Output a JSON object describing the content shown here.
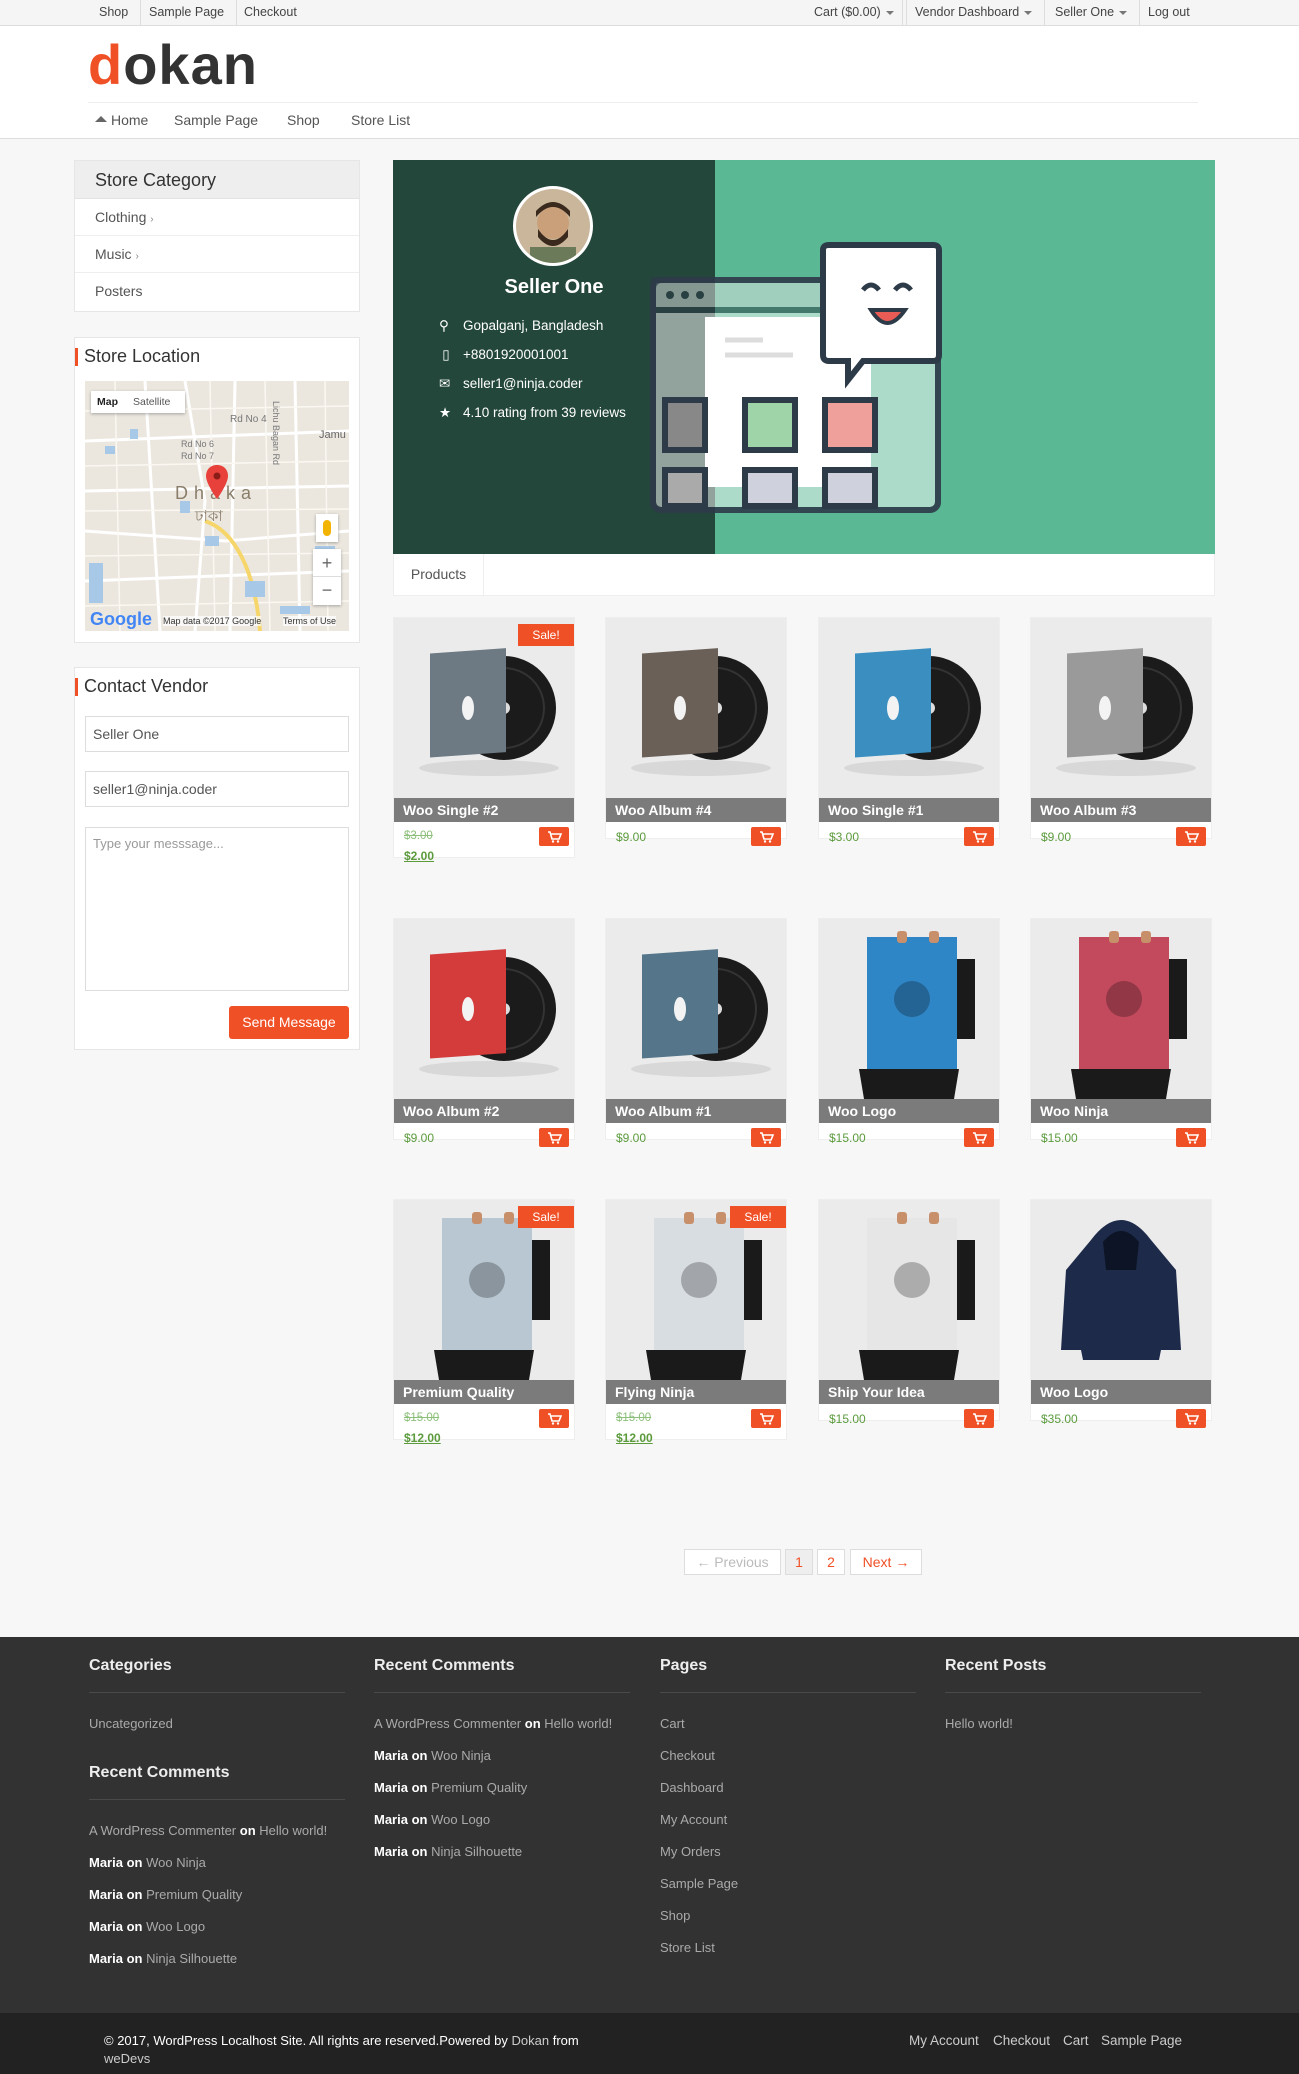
{
  "topbar": {
    "left": [
      "Shop",
      "Sample Page",
      "Checkout"
    ],
    "cart": "Cart ($0.00)",
    "vendor_dashboard": "Vendor Dashboard",
    "user": "Seller One",
    "logout": "Log out"
  },
  "header": {
    "logo_d": "d",
    "logo_rest": "okan",
    "nav": [
      "Home",
      "Sample Page",
      "Shop",
      "Store List"
    ]
  },
  "sidebar": {
    "category_title": "Store Category",
    "categories": [
      "Clothing",
      "Music",
      "Posters"
    ],
    "location_title": "Store Location",
    "map": {
      "tab_map": "Map",
      "tab_satellite": "Satellite",
      "label_city": "Dhaka",
      "label_city_local": "ঢাকা",
      "roads": [
        "Rd No 4",
        "Rd No 6",
        "Rd No 7",
        "Lichu Bagan Rd",
        "Jamu"
      ],
      "attribution": "Map data ©2017 Google",
      "terms": "Terms of Use",
      "google": "Google",
      "zoom_in": "+",
      "zoom_out": "−"
    },
    "contact_title": "Contact Vendor",
    "contact_name": "Seller One",
    "contact_email": "seller1@ninja.coder",
    "message_placeholder": "Type your messsage...",
    "send_label": "Send Message"
  },
  "store": {
    "name": "Seller One",
    "address": "Gopalganj, Bangladesh",
    "phone": "+8801920001001",
    "email": "seller1@ninja.coder",
    "rating": "4.10 rating from 39 reviews",
    "tab": "Products"
  },
  "products": [
    {
      "title": "Woo Single #2",
      "old": "$3.00",
      "price": "$2.00",
      "sale": "Sale!"
    },
    {
      "title": "Woo Album #4",
      "price": "$9.00"
    },
    {
      "title": "Woo Single #1",
      "price": "$3.00"
    },
    {
      "title": "Woo Album #3",
      "price": "$9.00"
    },
    {
      "title": "Woo Album #2",
      "price": "$9.00"
    },
    {
      "title": "Woo Album #1",
      "price": "$9.00"
    },
    {
      "title": "Woo Logo",
      "price": "$15.00"
    },
    {
      "title": "Woo Ninja",
      "price": "$15.00"
    },
    {
      "title": "Premium Quality",
      "old": "$15.00",
      "price": "$12.00",
      "sale": "Sale!"
    },
    {
      "title": "Flying Ninja",
      "old": "$15.00",
      "price": "$12.00",
      "sale": "Sale!"
    },
    {
      "title": "Ship Your Idea",
      "price": "$15.00"
    },
    {
      "title": "Woo Logo",
      "price": "$35.00"
    }
  ],
  "pagination": {
    "prev": "← Previous",
    "pages": [
      "1",
      "2"
    ],
    "next": "Next →"
  },
  "footer": {
    "categories_title": "Categories",
    "categories": [
      "Uncategorized"
    ],
    "recent_comments_title": "Recent Comments",
    "comments": [
      {
        "author": "A WordPress Commenter",
        "on": "on",
        "post": "Hello world!"
      },
      {
        "author": "Maria",
        "on": "on",
        "post": "Woo Ninja"
      },
      {
        "author": "Maria",
        "on": "on",
        "post": "Premium Quality"
      },
      {
        "author": "Maria",
        "on": "on",
        "post": "Woo Logo"
      },
      {
        "author": "Maria",
        "on": "on",
        "post": "Ninja Silhouette"
      }
    ],
    "pages_title": "Pages",
    "pages": [
      "Cart",
      "Checkout",
      "Dashboard",
      "My Account",
      "My Orders",
      "Sample Page",
      "Shop",
      "Store List"
    ],
    "recent_posts_title": "Recent Posts",
    "posts": [
      "Hello world!"
    ],
    "copyright": "© 2017, WordPress Localhost Site. All rights are reserved.Powered by",
    "powered_link": "Dokan",
    "from": "from",
    "wedevs": "weDevs",
    "bottom_links": [
      "My Account",
      "Checkout",
      "Cart",
      "Sample Page"
    ]
  },
  "colors": {
    "accent": "#f05025",
    "banner_dark": "#24473b",
    "banner_green": "#5ab894",
    "footer": "#323232",
    "price": "#5b9b3c"
  }
}
